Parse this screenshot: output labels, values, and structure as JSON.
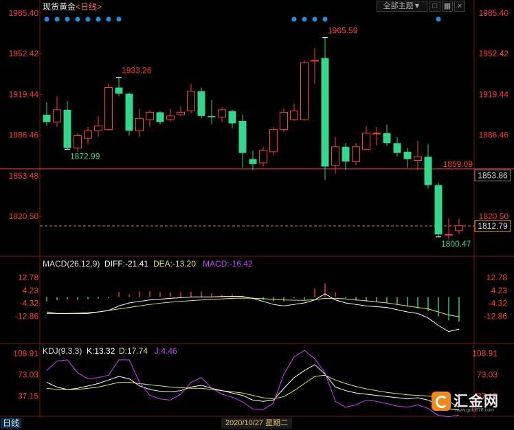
{
  "header": {
    "symbol": "现货黄金",
    "period": "<日线>",
    "theme_button": "全部主题▼",
    "close": "×"
  },
  "colors": {
    "up": "#ff3b3b",
    "down": "#33d68a",
    "axis_text": "#ff3b3b",
    "price_line": "#ff3b3b",
    "macd_diff": "#ffffff",
    "macd_dea": "#e4e464",
    "macd_label": "#cc44ff",
    "kdj_k": "#ffffff",
    "kdj_d": "#e4e464",
    "kdj_j": "#cc44ff",
    "dot": "#1f8fe0"
  },
  "logo": {
    "text": "汇金网",
    "url": "www.gold678.com"
  },
  "footer": {
    "period": "日线",
    "date": "2020/10/27 星期二"
  },
  "chart_data": [
    {
      "type": "candlestick",
      "y_ticks": [
        "1985.40",
        "1952.42",
        "1919.44",
        "1886.46",
        "1853.48",
        "1820.50"
      ],
      "ylim": [
        1790,
        1985.4
      ],
      "annotations": [
        {
          "label": "1965.59",
          "kind": "high"
        },
        {
          "label": "1933.26",
          "kind": "high"
        },
        {
          "label": "1872.99",
          "kind": "low"
        },
        {
          "label": "1800.47",
          "kind": "low"
        }
      ],
      "horizontal_lines": [
        {
          "label": "1859.09",
          "value": 1859.09,
          "style": "solid"
        },
        {
          "label": "1812.79",
          "value": 1812.79,
          "style": "dashed"
        }
      ],
      "right_labels": [
        {
          "label": "1853.86"
        },
        {
          "label": "1812.79"
        }
      ],
      "dots_top": [
        1,
        1,
        1,
        1,
        1,
        1,
        1,
        1,
        0,
        0,
        0,
        0,
        0,
        0,
        0,
        0,
        0,
        0,
        0,
        0,
        0,
        0,
        0,
        0,
        1,
        1,
        1,
        1,
        0,
        0,
        0,
        0,
        0,
        0,
        0,
        0,
        0,
        0,
        1
      ],
      "candles": [
        {
          "o": 1903,
          "h": 1913,
          "l": 1894,
          "c": 1897
        },
        {
          "o": 1897,
          "h": 1918,
          "l": 1893,
          "c": 1907
        },
        {
          "o": 1907,
          "h": 1914,
          "l": 1875,
          "c": 1876
        },
        {
          "o": 1876,
          "h": 1888,
          "l": 1873,
          "c": 1886
        },
        {
          "o": 1884,
          "h": 1893,
          "l": 1879,
          "c": 1890
        },
        {
          "o": 1890,
          "h": 1902,
          "l": 1885,
          "c": 1894
        },
        {
          "o": 1891,
          "h": 1928,
          "l": 1890,
          "c": 1925
        },
        {
          "o": 1925,
          "h": 1933.26,
          "l": 1918,
          "c": 1920
        },
        {
          "o": 1920,
          "h": 1921,
          "l": 1886,
          "c": 1890
        },
        {
          "o": 1890,
          "h": 1908,
          "l": 1885,
          "c": 1900
        },
        {
          "o": 1899,
          "h": 1907,
          "l": 1893,
          "c": 1905
        },
        {
          "o": 1905,
          "h": 1906,
          "l": 1895,
          "c": 1897
        },
        {
          "o": 1899,
          "h": 1908,
          "l": 1897,
          "c": 1902
        },
        {
          "o": 1903,
          "h": 1910,
          "l": 1902,
          "c": 1905
        },
        {
          "o": 1906,
          "h": 1928,
          "l": 1904,
          "c": 1922
        },
        {
          "o": 1922,
          "h": 1925,
          "l": 1900,
          "c": 1902
        },
        {
          "o": 1902,
          "h": 1915,
          "l": 1895,
          "c": 1901
        },
        {
          "o": 1901,
          "h": 1909,
          "l": 1897,
          "c": 1907
        },
        {
          "o": 1906,
          "h": 1907,
          "l": 1892,
          "c": 1896
        },
        {
          "o": 1898,
          "h": 1903,
          "l": 1860,
          "c": 1872
        },
        {
          "o": 1867,
          "h": 1874,
          "l": 1858,
          "c": 1863
        },
        {
          "o": 1864,
          "h": 1877,
          "l": 1861,
          "c": 1874
        },
        {
          "o": 1873,
          "h": 1893,
          "l": 1870,
          "c": 1891
        },
        {
          "o": 1891,
          "h": 1908,
          "l": 1889,
          "c": 1905
        },
        {
          "o": 1899,
          "h": 1912,
          "l": 1898,
          "c": 1906
        },
        {
          "o": 1899,
          "h": 1947,
          "l": 1898,
          "c": 1945
        },
        {
          "o": 1947,
          "h": 1957,
          "l": 1928,
          "c": 1947
        },
        {
          "o": 1949,
          "h": 1965.59,
          "l": 1850,
          "c": 1861
        },
        {
          "o": 1862,
          "h": 1885,
          "l": 1855,
          "c": 1877
        },
        {
          "o": 1877,
          "h": 1880,
          "l": 1858,
          "c": 1865
        },
        {
          "o": 1865,
          "h": 1880,
          "l": 1862,
          "c": 1877
        },
        {
          "o": 1875,
          "h": 1894,
          "l": 1874,
          "c": 1888
        },
        {
          "o": 1888,
          "h": 1893,
          "l": 1878,
          "c": 1888
        },
        {
          "o": 1888,
          "h": 1895,
          "l": 1878,
          "c": 1880
        },
        {
          "o": 1880,
          "h": 1885,
          "l": 1869,
          "c": 1872
        },
        {
          "o": 1873,
          "h": 1876,
          "l": 1860,
          "c": 1867
        },
        {
          "o": 1866,
          "h": 1882,
          "l": 1858,
          "c": 1869
        },
        {
          "o": 1869,
          "h": 1879,
          "l": 1843,
          "c": 1846
        },
        {
          "o": 1846,
          "h": 1848,
          "l": 1804,
          "c": 1806
        },
        {
          "o": 1806,
          "h": 1819,
          "l": 1802,
          "c": 1806
        },
        {
          "o": 1809,
          "h": 1819,
          "l": 1806,
          "c": 1813
        }
      ]
    },
    {
      "type": "bar",
      "indicator": "MACD",
      "title": "MACD(26,12,9)",
      "legend": [
        {
          "name": "DIFF",
          "label": "DIFF:-21.41",
          "color_key": "macd_diff"
        },
        {
          "name": "DEA",
          "label": "DEA:-13.20",
          "color_key": "macd_dea"
        },
        {
          "name": "MACD",
          "label": "MACD:-16.42",
          "color_key": "macd_label"
        }
      ],
      "y_ticks": [
        "12.78",
        "4.23",
        "-4.32",
        "-12.86"
      ],
      "ylim": [
        -30,
        22
      ],
      "hist": [
        -3,
        -2.2,
        -1.6,
        -1.9,
        -1.6,
        -1.2,
        -0.8,
        3.2,
        1.5,
        3.6,
        3.6,
        3.1,
        2.9,
        3.0,
        3.3,
        3.5,
        2.4,
        1.6,
        1.7,
        0.8,
        -0.4,
        -2.0,
        -2.8,
        -3.0,
        -0.8,
        -1.9,
        5.5,
        8.9,
        3.0,
        -0.8,
        -2.5,
        -3.3,
        -3.6,
        -4.2,
        -5.5,
        -6.5,
        -7.7,
        -9.5,
        -13,
        -15.5,
        -16.42
      ],
      "diff": [
        -10,
        -11,
        -11,
        -11,
        -11,
        -10,
        -9,
        -6,
        -4,
        -3,
        -2,
        -1.5,
        -1,
        -0.5,
        0,
        0,
        0,
        0.2,
        0.3,
        0.3,
        -1,
        -3,
        -5,
        -6,
        -5,
        -4,
        -2,
        2,
        -2,
        -4,
        -5,
        -6,
        -6.5,
        -7,
        -8.5,
        -10,
        -11,
        -14,
        -19,
        -23,
        -21.41
      ],
      "dea": [
        -11,
        -11,
        -11,
        -10.8,
        -10.5,
        -10,
        -9,
        -8,
        -7,
        -6,
        -5,
        -4.2,
        -3.5,
        -3,
        -2.5,
        -2,
        -1.6,
        -1.3,
        -1,
        -0.8,
        -0.9,
        -1.2,
        -1.6,
        -2,
        -2.2,
        -2.3,
        -1.8,
        -1,
        -1,
        -1.3,
        -2,
        -2.6,
        -3.3,
        -4,
        -5,
        -6,
        -7,
        -8,
        -10,
        -12,
        -13.2
      ]
    },
    {
      "type": "line",
      "indicator": "KDJ",
      "title": "KDJ(9,3,3)",
      "legend": [
        {
          "name": "K",
          "label": "K:13.32",
          "color_key": "kdj_k"
        },
        {
          "name": "D",
          "label": "D:17.74",
          "color_key": "kdj_d"
        },
        {
          "name": "J",
          "label": "J:4.46",
          "color_key": "kdj_j"
        }
      ],
      "y_ticks": [
        "108.91",
        "73.03",
        "37.15"
      ],
      "ylim": [
        5,
        113
      ],
      "k": [
        60,
        52,
        48,
        50,
        54,
        58,
        64,
        70,
        66,
        54,
        48,
        45,
        44,
        46,
        52,
        55,
        50,
        46,
        42,
        38,
        30,
        28,
        30,
        50,
        68,
        80,
        90,
        74,
        52,
        46,
        42,
        40,
        38,
        36,
        34,
        32,
        34,
        30,
        22,
        15,
        13.32
      ],
      "d": [
        50,
        48,
        48,
        48,
        50,
        52,
        56,
        60,
        60,
        58,
        56,
        54,
        52,
        51,
        50,
        50,
        48,
        46,
        44,
        42,
        38,
        34,
        32,
        36,
        46,
        58,
        70,
        72,
        64,
        58,
        53,
        49,
        46,
        43,
        41,
        39,
        38,
        37,
        34,
        28,
        17.74
      ],
      "j": [
        80,
        96,
        98,
        76,
        66,
        68,
        72,
        98,
        98,
        60,
        38,
        32,
        30,
        40,
        60,
        68,
        50,
        40,
        35,
        27,
        15,
        14,
        25,
        74,
        103,
        114,
        100,
        76,
        28,
        18,
        22,
        30,
        28,
        24,
        20,
        18,
        22,
        16,
        4,
        2,
        4.46
      ]
    }
  ]
}
